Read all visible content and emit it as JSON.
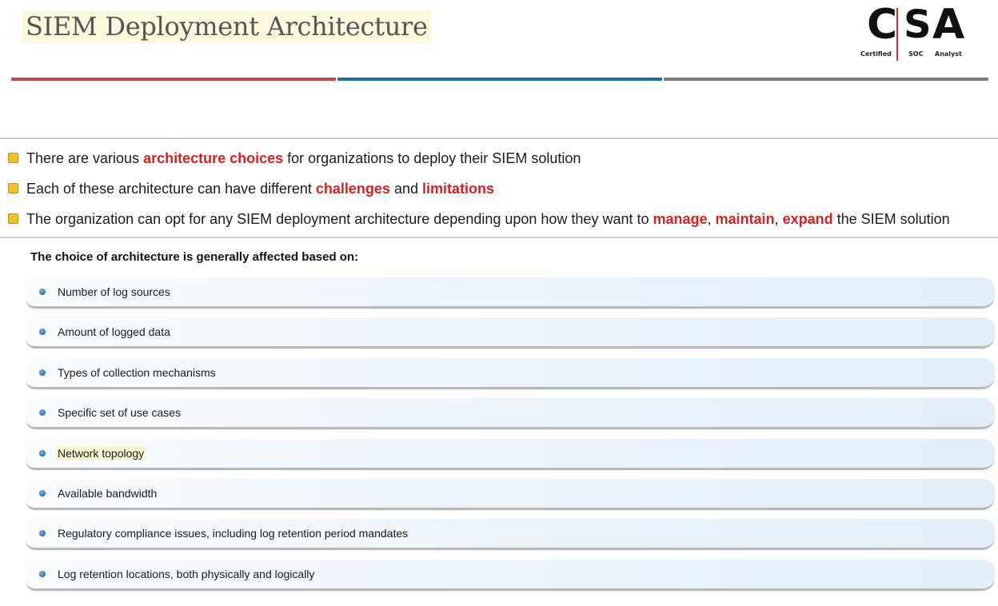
{
  "slide": {
    "title": "SIEM Deployment Architecture"
  },
  "logo": {
    "letters": [
      "C",
      "S",
      "A"
    ],
    "captions": [
      "Certified",
      "SOC",
      "Analyst"
    ]
  },
  "colors": {
    "highlight_red": "#d62222",
    "bar_red": "#c44a4a",
    "bar_blue": "#1c6fa8",
    "bar_gray": "#7a7a7a",
    "bullet_yellow": "#f0c229"
  },
  "bullets": [
    {
      "parts": [
        {
          "text": "There are various ",
          "hl": false
        },
        {
          "text": "architecture choices",
          "hl": true
        },
        {
          "text": " for organizations to deploy their SIEM solution",
          "hl": false
        }
      ]
    },
    {
      "parts": [
        {
          "text": "Each of these architecture can have different ",
          "hl": false
        },
        {
          "text": "challenges",
          "hl": true
        },
        {
          "text": " and ",
          "hl": false
        },
        {
          "text": "limitations",
          "hl": true
        }
      ]
    },
    {
      "parts": [
        {
          "text": "The organization can opt for any SIEM deployment architecture depending upon how they want to ",
          "hl": false
        },
        {
          "text": "manage",
          "hl": true
        },
        {
          "text": ", ",
          "hl": false
        },
        {
          "text": "maintain",
          "hl": true
        },
        {
          "text": ", ",
          "hl": false
        },
        {
          "text": "expand",
          "hl": true
        },
        {
          "text": " the SIEM solution",
          "hl": false
        }
      ]
    }
  ],
  "factors": {
    "heading": "The choice of architecture is generally affected based on:",
    "items": [
      "Number of log sources",
      "Amount of logged data",
      "Types of collection mechanisms",
      "Specific set of use cases",
      "Network topology",
      "Available bandwidth",
      "Regulatory compliance issues, including log retention period mandates",
      "Log retention locations, both physically and logically"
    ]
  }
}
